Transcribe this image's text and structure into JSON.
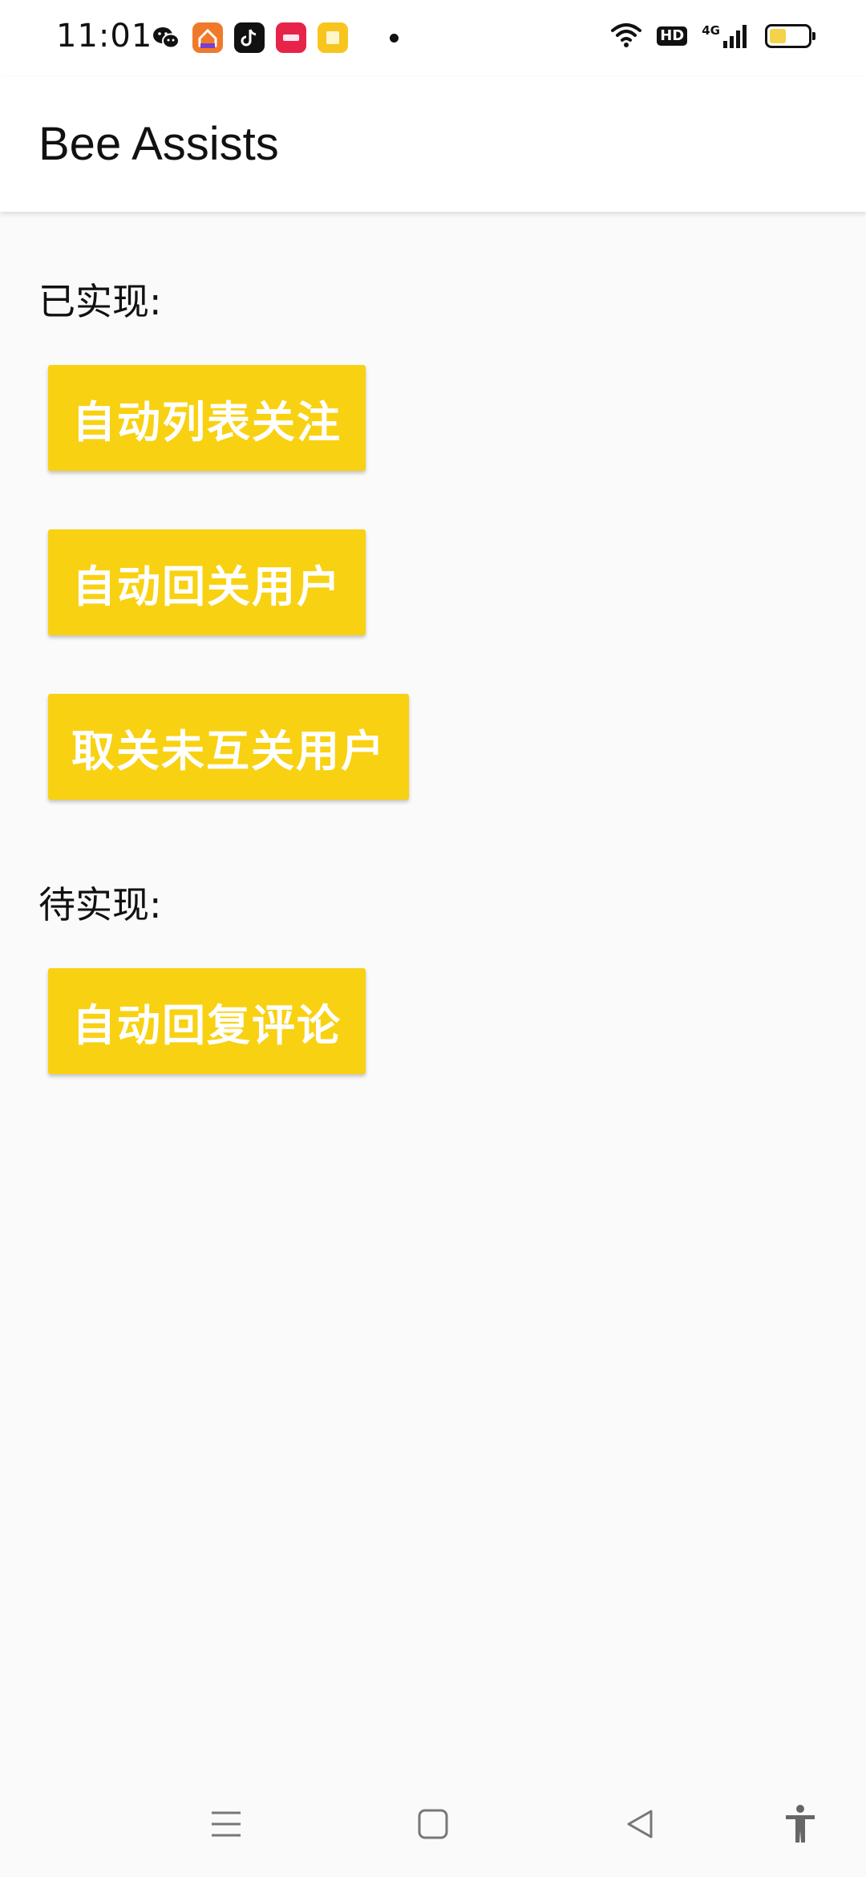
{
  "status_bar": {
    "time": "11:01",
    "network": "4G",
    "hd": "HD",
    "notification_icons": [
      "wechat-icon",
      "app-orange-icon",
      "tiktok-icon",
      "xiaohongshu-icon",
      "app-yellow-icon"
    ]
  },
  "app_bar": {
    "title": "Bee Assists"
  },
  "sections": {
    "implemented_label": "已实现:",
    "pending_label": "待实现:"
  },
  "buttons": {
    "auto_list_follow": "自动列表关注",
    "auto_follow_back": "自动回关用户",
    "unfollow_non_mutual": "取关未互关用户",
    "auto_reply_comments": "自动回复评论"
  },
  "colors": {
    "accent": "#f8d112",
    "background": "#fafafa",
    "app_bar": "#ffffff"
  }
}
